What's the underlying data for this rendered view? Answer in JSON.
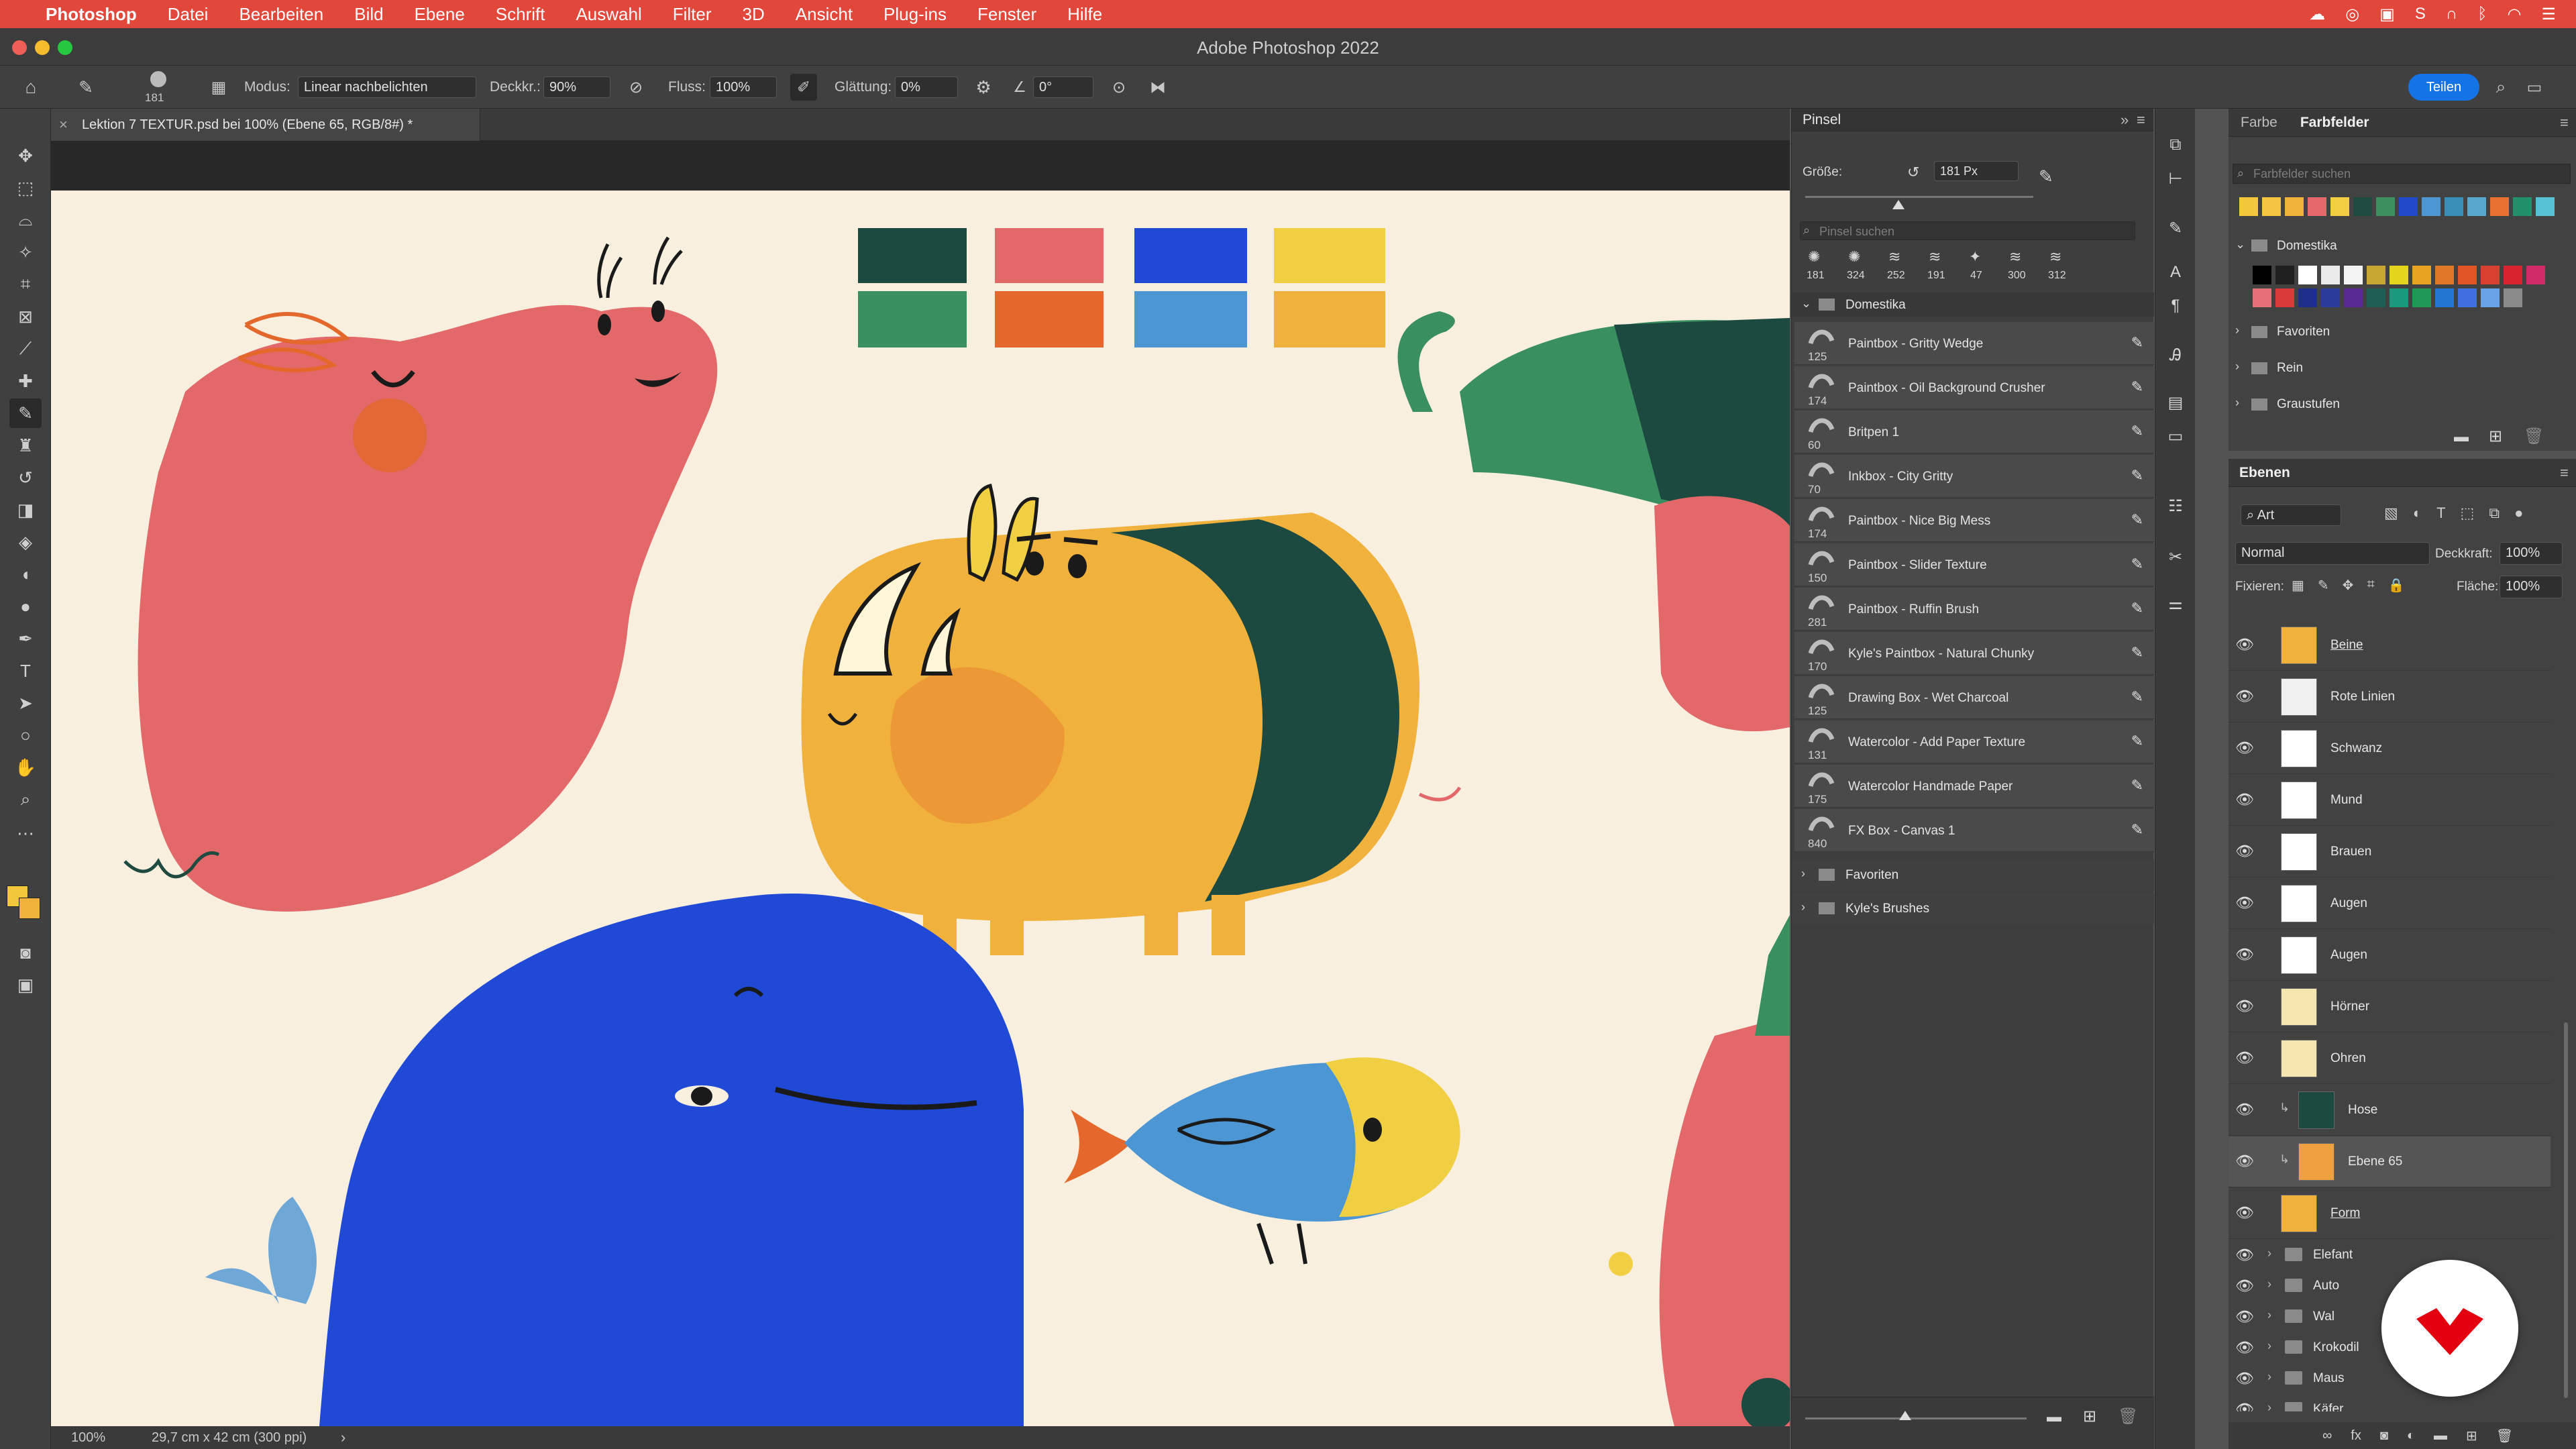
{
  "menubar": {
    "items": [
      "Photoshop",
      "Datei",
      "Bearbeiten",
      "Bild",
      "Ebene",
      "Schrift",
      "Auswahl",
      "Filter",
      "3D",
      "Ansicht",
      "Plug-ins",
      "Fenster",
      "Hilfe"
    ]
  },
  "window": {
    "title": "Adobe Photoshop 2022",
    "share_label": "Teilen"
  },
  "options": {
    "brush_size": "181",
    "mode_label": "Modus:",
    "mode_value": "Linear nachbelichten",
    "opacity_label": "Deckkr.:",
    "opacity_value": "90%",
    "flow_label": "Fluss:",
    "flow_value": "100%",
    "smoothing_label": "Glättung:",
    "smoothing_value": "0%",
    "angle_value": "0°"
  },
  "document": {
    "tab_title": "Lektion 7 TEXTUR.psd bei 100% (Ebene 65, RGB/8#) *",
    "zoom": "100%",
    "doc_size": "29,7 cm x 42 cm (300 ppi)"
  },
  "brushes_panel": {
    "title": "Pinsel",
    "size_label": "Größe:",
    "size_value": "181 Px",
    "size_fraction": 0.41,
    "search_placeholder": "Pinsel suchen",
    "recent_sizes": [
      "181",
      "324",
      "252",
      "191",
      "47",
      "300",
      "312"
    ],
    "group_open": "Domestika",
    "brushes": [
      {
        "size": "125",
        "name": "Paintbox - Gritty Wedge"
      },
      {
        "size": "174",
        "name": "Paintbox - Oil Background Crusher"
      },
      {
        "size": "60",
        "name": "Britpen 1"
      },
      {
        "size": "70",
        "name": "Inkbox - City Gritty"
      },
      {
        "size": "174",
        "name": "Paintbox - Nice Big Mess"
      },
      {
        "size": "150",
        "name": "Paintbox - Slider Texture"
      },
      {
        "size": "281",
        "name": "Paintbox - Ruffin Brush"
      },
      {
        "size": "170",
        "name": "Kyle's Paintbox - Natural Chunky"
      },
      {
        "size": "125",
        "name": "Drawing Box - Wet Charcoal"
      },
      {
        "size": "131",
        "name": "Watercolor - Add Paper Texture"
      },
      {
        "size": "175",
        "name": "Watercolor Handmade Paper"
      },
      {
        "size": "840",
        "name": "FX Box - Canvas 1"
      }
    ],
    "closed_groups": [
      "Favoriten",
      "Kyle's Brushes"
    ]
  },
  "swatches_panel": {
    "tab_color": "Farbe",
    "tab_swatches": "Farbfelder",
    "search_placeholder": "Farbfelder suchen",
    "recent": [
      "#f2c73a",
      "#f5c542",
      "#f0b23a",
      "#e2686a",
      "#f2cf41",
      "#1f4a3f",
      "#3c8f5f",
      "#2149c9",
      "#4c96d4",
      "#3a8fb8",
      "#55a8c9",
      "#e87030",
      "#20906a",
      "#56c2d4"
    ],
    "group_open": "Domestika",
    "domestika_row1": [
      "#000000",
      "#202020",
      "#ffffff",
      "#eaeaea",
      "#f3f3f3",
      "#c8a732",
      "#e4d51c",
      "#e8a421",
      "#e07925",
      "#e15624",
      "#d8402f",
      "#d9232f",
      "#d02a67"
    ],
    "domestika_row2": [
      "#e5707a",
      "#d93b3b",
      "#1f2d8c",
      "#2a3b9c",
      "#5a2a94",
      "#1e5f55",
      "#199a7c",
      "#1f9a54",
      "#2377d2",
      "#3f6fe0",
      "#6aa2e8",
      "#8a8a8a"
    ],
    "closed_groups": [
      "Favoriten",
      "Rein",
      "Graustufen"
    ]
  },
  "layers_panel": {
    "title": "Ebenen",
    "filter_label": "Art",
    "blend_mode": "Normal",
    "opacity_label": "Deckkraft:",
    "opacity_value": "100%",
    "lock_label": "Fixieren:",
    "fill_label": "Fläche:",
    "fill_value": "100%",
    "layers": [
      "Beine",
      "Rote Linien",
      "Schwanz",
      "Mund",
      "Brauen",
      "Augen",
      "Augen",
      "Hörner",
      "Ohren",
      "Hose",
      "Ebene 65",
      "Form"
    ],
    "groups": [
      "Elefant",
      "Auto",
      "Wal",
      "Krokodil",
      "Maus",
      "Käfer"
    ]
  },
  "canvas": {
    "palette": [
      "#1d4a40",
      "#e2686a",
      "#2049d6",
      "#f1cf42",
      "#3a8f60",
      "#e4682c",
      "#4c96d4",
      "#f0b23c"
    ]
  }
}
